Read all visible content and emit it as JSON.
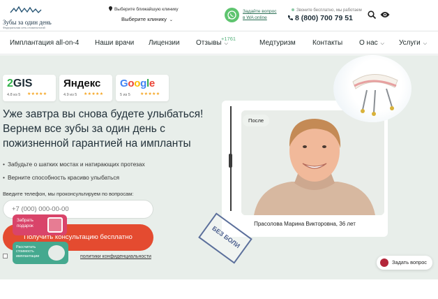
{
  "logo": {
    "name": "Зубы за один день",
    "subtitle": "Федеральная сеть стоматологий"
  },
  "header": {
    "location_prompt": "Выберите ближайшую клинику",
    "city_select": "Выберите клинику",
    "whatsapp_line1": "Задайте вопрос",
    "whatsapp_line2": "в WA online",
    "call_note": "Звоните бесплатно, мы работаем",
    "phone": "8 (800) 700 79 51"
  },
  "nav": {
    "items": [
      {
        "label": "Имплантация all-on-4"
      },
      {
        "label": "Наши врачи"
      },
      {
        "label": "Лицензии"
      },
      {
        "label": "Отзывы"
      },
      {
        "label": "Медтуризм"
      },
      {
        "label": "Контакты"
      },
      {
        "label": "О нас"
      },
      {
        "label": "Услуги"
      }
    ],
    "reviews_count": "+1761"
  },
  "ratings": [
    {
      "brand": "2GIS",
      "score": "4.8 из 5"
    },
    {
      "brand": "Яндекс",
      "score": "4.9 из 5"
    },
    {
      "brand": "Google",
      "score": "5 из 5"
    }
  ],
  "hero": {
    "headline_line1": "Уже завтра вы снова будете улыбаться!",
    "headline_line2": "Вернем все зубы за один день с",
    "headline_line3": "пожизненной гарантией на импланты",
    "bullets": [
      "Забудьте о шатких мостах и натирающих протезах",
      "Верните способность красиво улыбаться"
    ],
    "form_hint": "Введите телефон, мы проконсультируем по вопросам:",
    "phone_placeholder": "+7 (000) 000-00-00",
    "cta_label": "Получить консультацию бесплатно",
    "privacy_text": "политики конфиденциальности"
  },
  "widgets": {
    "gift_line1": "Забрать",
    "gift_line2": "подарок",
    "calc_line1": "Рассчитать",
    "calc_line2": "стоимость",
    "calc_line3": "имплантации"
  },
  "case": {
    "label": "После",
    "patient": "Прасолова Марина Викторовна, 36 лет",
    "stamp": "БЕЗ БОЛИ"
  },
  "ask_button": "Задать вопрос",
  "colors": {
    "accent": "#e44b30",
    "hero_bg": "#e8eeea",
    "whatsapp": "#5ec46f",
    "gift": "#d9446a",
    "calc": "#45a98f"
  }
}
